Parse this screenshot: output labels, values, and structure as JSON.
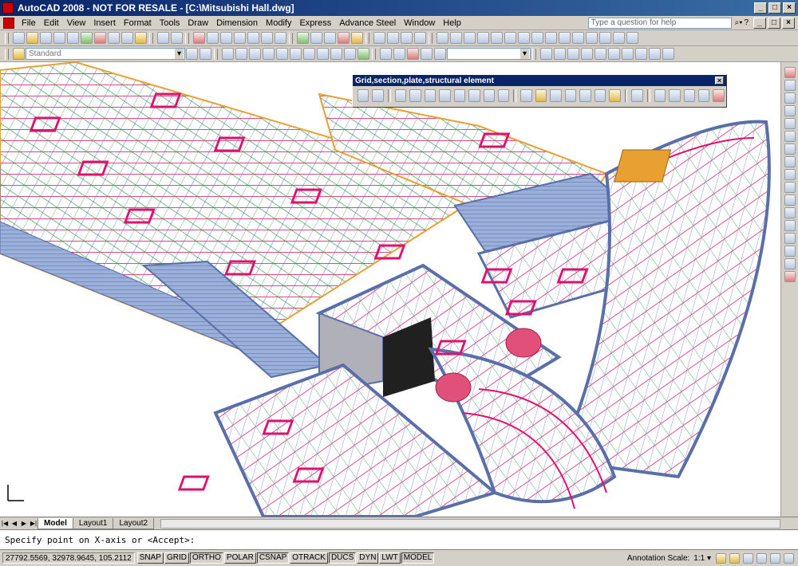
{
  "window": {
    "title": "AutoCAD 2008 - NOT FOR RESALE - [C:\\Mitsubishi Hall.dwg]",
    "controls": {
      "minimize": "_",
      "maximize": "□",
      "close": "×"
    }
  },
  "menubar": {
    "items": [
      "File",
      "Edit",
      "View",
      "Insert",
      "Format",
      "Tools",
      "Draw",
      "Dimension",
      "Modify",
      "Express",
      "Advance Steel",
      "Window",
      "Help"
    ],
    "help_placeholder": "Type a question for help"
  },
  "toolbars": {
    "style_combo": "Standard"
  },
  "floating_toolbar": {
    "title": "Grid,section,plate,structural element",
    "close": "×"
  },
  "layout_tabs": {
    "tabs": [
      "Model",
      "Layout1",
      "Layout2"
    ],
    "active": "Model",
    "nav": [
      "|◀",
      "◀",
      "▶",
      "▶|"
    ]
  },
  "command_line": {
    "prompt": "Specify point on X-axis or <Accept>:"
  },
  "status_bar": {
    "coordinates": "27792.5569, 32978.9645, 105.2112",
    "buttons": [
      {
        "label": "SNAP",
        "on": false
      },
      {
        "label": "GRID",
        "on": false
      },
      {
        "label": "ORTHO",
        "on": true
      },
      {
        "label": "POLAR",
        "on": false
      },
      {
        "label": "CSNAP",
        "on": true
      },
      {
        "label": "OTRACK",
        "on": false
      },
      {
        "label": "DUCS",
        "on": true
      },
      {
        "label": "DYN",
        "on": false
      },
      {
        "label": "LWT",
        "on": false
      },
      {
        "label": "MODEL",
        "on": true
      }
    ],
    "annotation_scale_label": "Annotation Scale:",
    "annotation_scale_value": "1:1 ▾"
  },
  "colors": {
    "title_bar": "#0a246a",
    "beam_magenta": "#e0106e",
    "beam_blue": "#6a78b8",
    "brace_green": "#2aa04a",
    "purlin_orange": "#e8a030"
  }
}
